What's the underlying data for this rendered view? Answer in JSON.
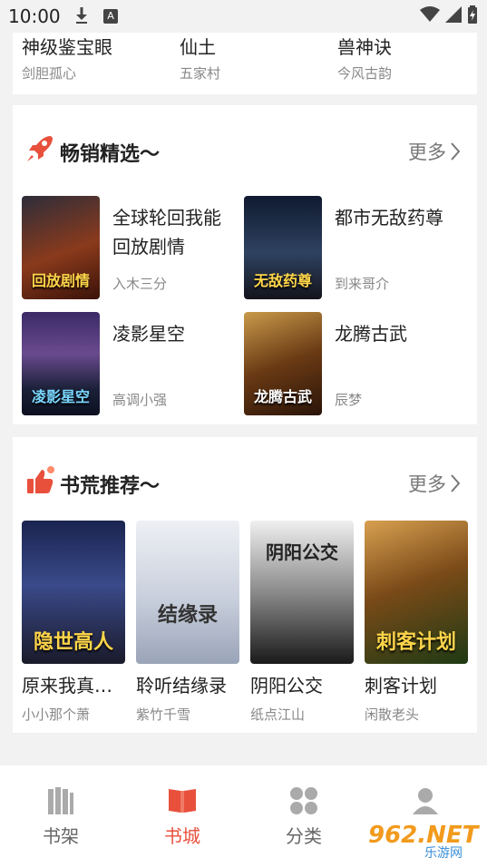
{
  "status_bar": {
    "time": "10:00",
    "accessibility_badge": "A"
  },
  "top_list": [
    {
      "title": "神级鉴宝眼",
      "author": "剑胆孤心"
    },
    {
      "title": "仙土",
      "author": "五家村"
    },
    {
      "title": "兽神诀",
      "author": "今风古韵"
    }
  ],
  "bestseller": {
    "title": "畅销精选～",
    "more": "更多",
    "icon": "rocket-icon",
    "books": [
      {
        "title": "全球轮回我能回放剧情",
        "author": "入木三分",
        "cover_text": "回放剧情",
        "cover_bg": "#6b2a1e"
      },
      {
        "title": "都市无敌药尊",
        "author": "到来哥介",
        "cover_text": "无敌药尊",
        "cover_bg": "#1c2a44"
      },
      {
        "title": "凌影星空",
        "author": "高调小强",
        "cover_text": "凌影星空",
        "cover_bg": "#2b2350"
      },
      {
        "title": "龙腾古武",
        "author": "辰梦",
        "cover_text": "龙腾古武",
        "cover_bg": "#5a3214"
      }
    ]
  },
  "recommend": {
    "title": "书荒推荐～",
    "more": "更多",
    "icon": "thumbs-up-icon",
    "books": [
      {
        "title": "原来我真…",
        "author": "小小那个萧",
        "cover_text": "隐世高人",
        "cover_bg": "#1f2b55"
      },
      {
        "title": "聆听结缘录",
        "author": "紫竹千雪",
        "cover_text": "结缘录",
        "cover_bg": "#d9dde6"
      },
      {
        "title": "阴阳公交",
        "author": "纸点江山",
        "cover_text": "阴阳公交",
        "cover_bg": "#3a3a3a"
      },
      {
        "title": "刺客计划",
        "author": "闲散老头",
        "cover_text": "刺客计划",
        "cover_bg": "#4a2f16"
      }
    ]
  },
  "bottom_nav": [
    {
      "label": "书架",
      "icon": "bookshelf-icon",
      "active": false
    },
    {
      "label": "书城",
      "icon": "open-book-icon",
      "active": true
    },
    {
      "label": "分类",
      "icon": "category-grid-icon",
      "active": false
    },
    {
      "label": "",
      "icon": "profile-icon",
      "active": false
    }
  ],
  "watermark": {
    "brand": "962.NET",
    "subtitle": "乐游网"
  },
  "colors": {
    "accent": "#e8503c",
    "muted": "#888888",
    "background": "#f2f2f2"
  }
}
